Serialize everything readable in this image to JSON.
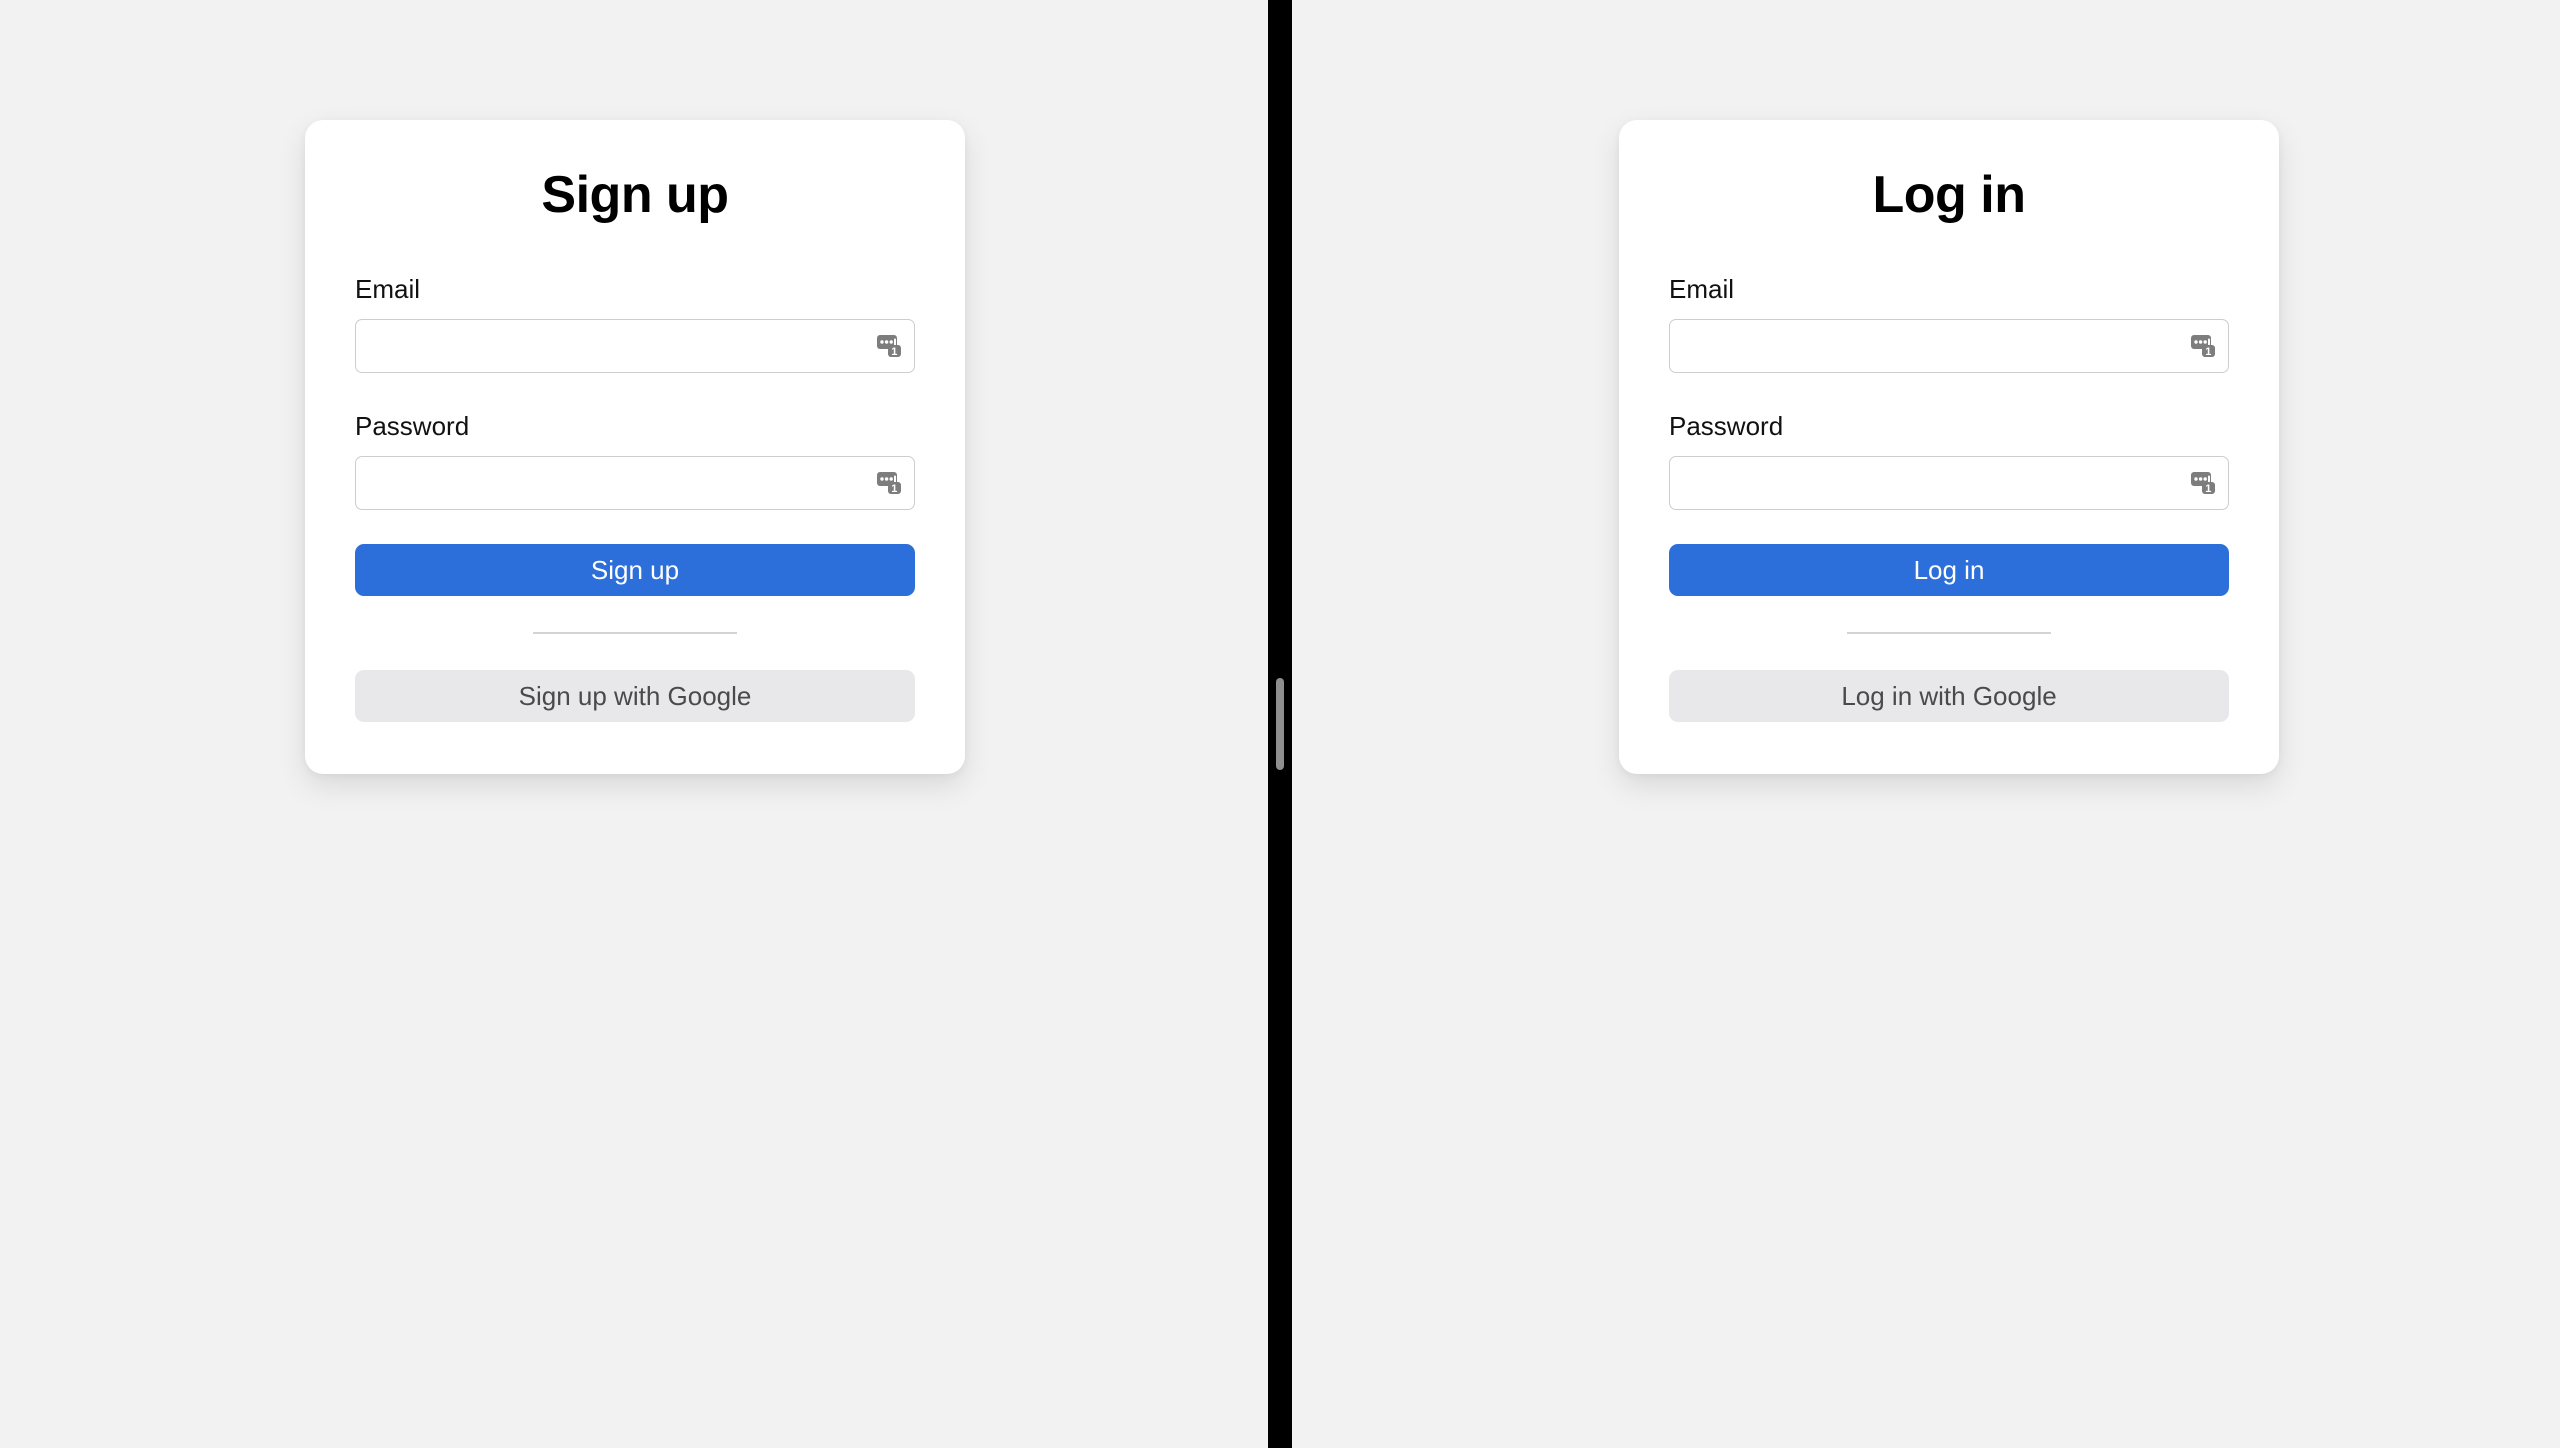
{
  "page": {
    "background_color": "#f2f2f2",
    "accent_color": "#2c6fda",
    "secondary_button_color": "#e8e8ea",
    "card_background": "#ffffff"
  },
  "splitter": {
    "name": "pane-splitter",
    "color": "#000000",
    "handle_color": "#8f8f8f"
  },
  "signup_card": {
    "title": "Sign up",
    "email": {
      "label": "Email",
      "value": "",
      "placeholder": "",
      "icon": "password-manager-autofill-icon",
      "icon_badge": "1"
    },
    "password": {
      "label": "Password",
      "value": "",
      "placeholder": "",
      "icon": "password-manager-autofill-icon",
      "icon_badge": "1"
    },
    "primary_button": "Sign up",
    "google_button": "Sign up with Google"
  },
  "login_card": {
    "title": "Log in",
    "email": {
      "label": "Email",
      "value": "",
      "placeholder": "",
      "icon": "password-manager-autofill-icon",
      "icon_badge": "1"
    },
    "password": {
      "label": "Password",
      "value": "",
      "placeholder": "",
      "icon": "password-manager-autofill-icon",
      "icon_badge": "1"
    },
    "primary_button": "Log in",
    "google_button": "Log in with Google"
  }
}
